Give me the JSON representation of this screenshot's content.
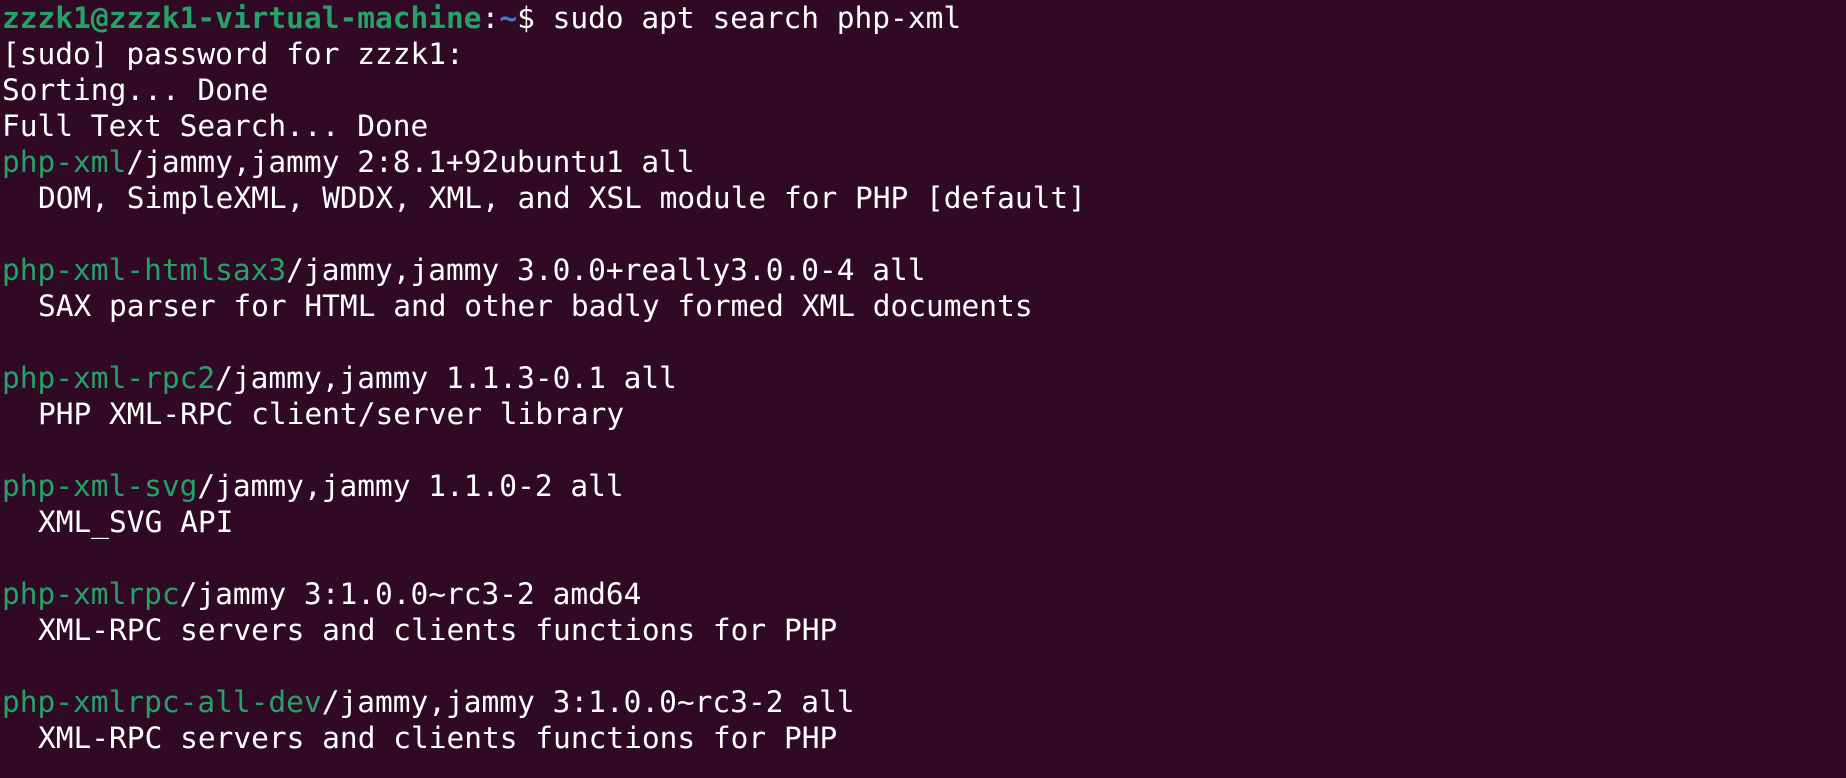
{
  "colors": {
    "background": "#300a24",
    "foreground": "#ffffff",
    "user_host": "#26a269",
    "path": "#3d7fd6",
    "package_name": "#26a269"
  },
  "prompt": {
    "user_host": "zzzk1@zzzk1-virtual-machine",
    "separator": ":",
    "path": "~",
    "symbol": "$ ",
    "command": "sudo apt search php-xml"
  },
  "output": {
    "sudo_prompt": "[sudo] password for zzzk1:",
    "sorting": "Sorting... Done",
    "full_text": "Full Text Search... Done"
  },
  "packages": [
    {
      "name": "php-xml",
      "details": "/jammy,jammy 2:8.1+92ubuntu1 all",
      "description": "DOM, SimpleXML, WDDX, XML, and XSL module for PHP [default]"
    },
    {
      "name": "php-xml-htmlsax3",
      "details": "/jammy,jammy 3.0.0+really3.0.0-4 all",
      "description": "SAX parser for HTML and other badly formed XML documents"
    },
    {
      "name": "php-xml-rpc2",
      "details": "/jammy,jammy 1.1.3-0.1 all",
      "description": "PHP XML-RPC client/server library"
    },
    {
      "name": "php-xml-svg",
      "details": "/jammy,jammy 1.1.0-2 all",
      "description": "XML_SVG API"
    },
    {
      "name": "php-xmlrpc",
      "details": "/jammy 3:1.0.0~rc3-2 amd64",
      "description": "XML-RPC servers and clients functions for PHP"
    },
    {
      "name": "php-xmlrpc-all-dev",
      "details": "/jammy,jammy 3:1.0.0~rc3-2 all",
      "description": "XML-RPC servers and clients functions for PHP"
    }
  ]
}
